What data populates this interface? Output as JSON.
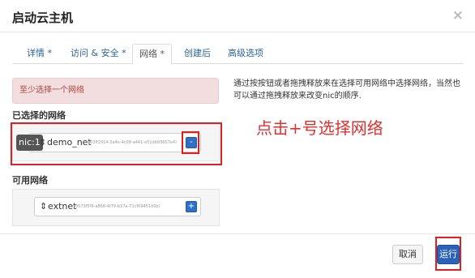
{
  "modal": {
    "title": "启动云主机",
    "close_glyph": "×"
  },
  "tabs": [
    {
      "label": "详情 *",
      "active": false
    },
    {
      "label": "访问 & 安全 *",
      "active": false
    },
    {
      "label": "网络 *",
      "active": true
    },
    {
      "label": "创建后",
      "active": false
    },
    {
      "label": "高级选项",
      "active": false
    }
  ],
  "network": {
    "alert": "至少选择一个网络",
    "selected_label": "已选择的网络",
    "available_label": "可用网络",
    "selected": [
      {
        "nic": "nic:1",
        "name": "demo_net",
        "id": "(63ff2014-3a4e-4c08-a441-e51db93607e4)",
        "button": "-"
      }
    ],
    "available": [
      {
        "name": "extnet",
        "id": "(9573f5f9-a868-4f79-b37a-71cf0945100b)",
        "button": "+"
      }
    ],
    "drag_glyph": "⇕"
  },
  "help": {
    "text": "通过按按钮或者拖拽释放来在选择可用网络中选择网络，当然也可以通过拖拽释放来改变nic的顺序."
  },
  "annotation": {
    "text": "点击+号选择网络",
    "color": "#e03030"
  },
  "footer": {
    "cancel_label": "取消",
    "run_label": "运行"
  },
  "colors": {
    "primary": "#2a62b8",
    "alert_bg": "#f2dede",
    "alert_text": "#a94442",
    "highlight_frame": "#e02020"
  }
}
